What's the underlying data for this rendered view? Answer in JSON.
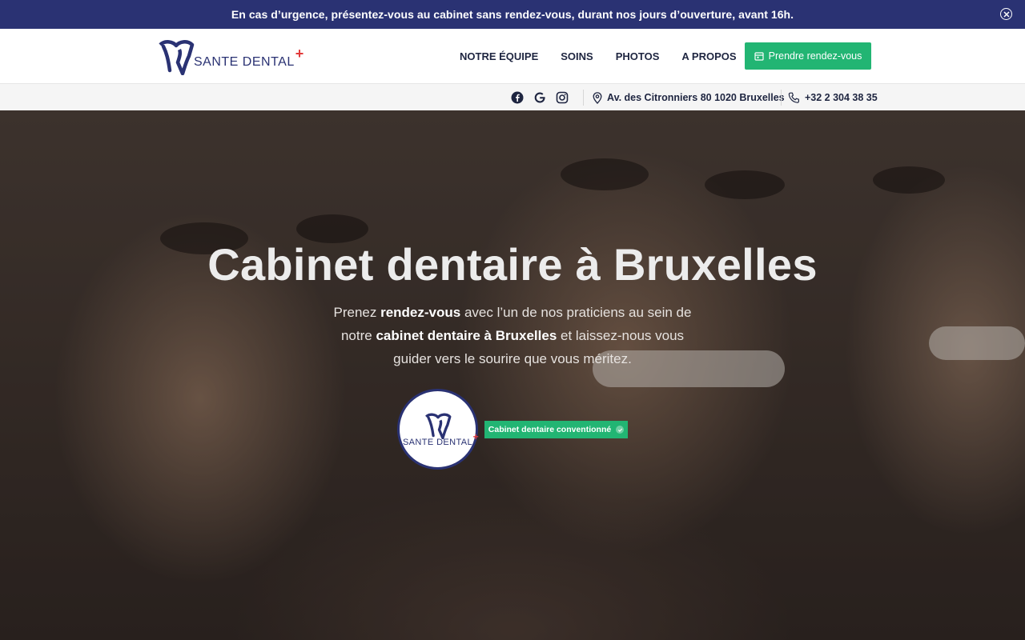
{
  "announcement": {
    "text": "En cas d’urgence, présentez-vous au cabinet sans rendez-vous, durant nos jours d’ouverture, avant 16h.",
    "close_icon": "close-circle-icon"
  },
  "brand": {
    "name": "SANTE DENTAL",
    "plus": "+",
    "colors": {
      "navy": "#2a3273",
      "green": "#22b573",
      "red": "#e23a3a"
    }
  },
  "nav": {
    "items": [
      {
        "label": "NOTRE ÉQUIPE"
      },
      {
        "label": "SOINS"
      },
      {
        "label": "PHOTOS"
      },
      {
        "label": "A PROPOS"
      }
    ],
    "cta_label": "Prendre rendez-vous",
    "cta_icon": "calendar-icon"
  },
  "infobar": {
    "social": [
      "facebook-icon",
      "google-icon",
      "instagram-icon"
    ],
    "address": "Av. des Citronniers 80 1020 Bruxelles",
    "phone": "+32 2 304 38 35"
  },
  "hero": {
    "title": "Cabinet dentaire à Bruxelles",
    "lead_parts": {
      "p1": "Prenez ",
      "b1": "rendez-vous",
      "p2": " avec l’un de nos praticiens au sein de notre ",
      "b2": "cabinet dentaire à Bruxelles",
      "p3": " et laissez-nous vous guider vers le sourire que vous méritez."
    },
    "badge_logo_text": "SANTE DENTAL",
    "badge_label": "Cabinet dentaire conventionné"
  }
}
